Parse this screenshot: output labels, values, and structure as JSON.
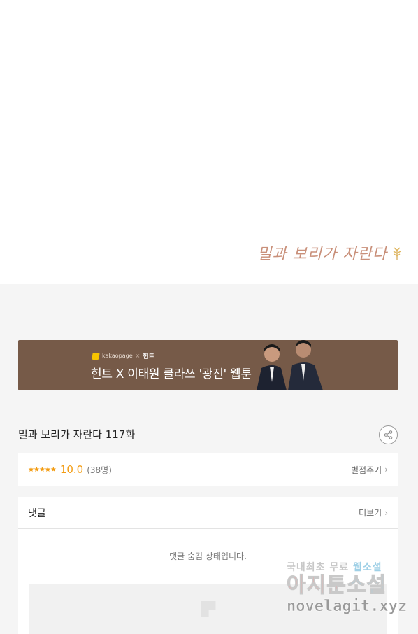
{
  "comic_logo": {
    "text": "밀과 보리가 자란다"
  },
  "banner": {
    "brand_left": "kakaopage",
    "brand_sep": "×",
    "brand_right": "헌트",
    "title": "헌트 X 이태원 클라쓰 '광진' 웹툰"
  },
  "episode": {
    "title": "밀과 보리가 자란다 117화",
    "share_icon": "share-icon"
  },
  "rating": {
    "stars": "★★★★★",
    "score": "10.0",
    "count": "(38명)",
    "rate_label": "별점주기",
    "chevron": "›"
  },
  "comments": {
    "title": "댓글",
    "more_label": "더보기",
    "chevron": "›",
    "hidden_message": "댓글 숨김 상태입니다."
  },
  "watermark": {
    "line1_a": "국내최초 무료 ",
    "line1_b": "웹소설",
    "line2_a": "아지툰",
    "line2_b": "소설",
    "line3": "novelagit.xyz"
  },
  "colors": {
    "accent": "#f39c12",
    "banner_bg": "#765a48",
    "page_bg": "#f5f5f5"
  }
}
